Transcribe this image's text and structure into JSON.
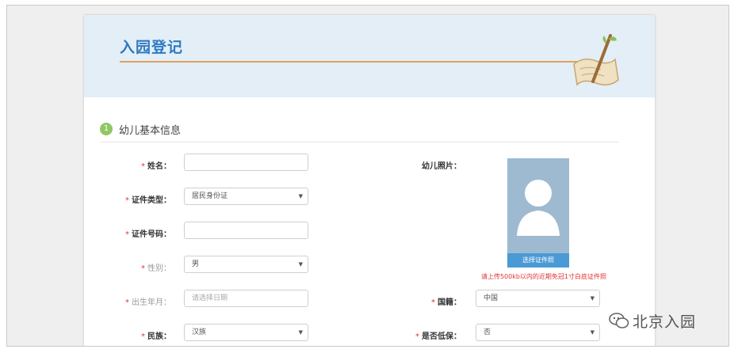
{
  "header": {
    "title": "入园登记"
  },
  "section": {
    "step": "1",
    "title": "幼儿基本信息"
  },
  "form": {
    "name": {
      "label": "姓名：",
      "value": ""
    },
    "id_type": {
      "label": "证件类型：",
      "value": "居民身份证"
    },
    "id_number": {
      "label": "证件号码：",
      "value": ""
    },
    "gender": {
      "label": "性别：",
      "value": "男"
    },
    "birth": {
      "label": "出生年月：",
      "placeholder": "请选择日期"
    },
    "ethnicity": {
      "label": "民族：",
      "value": "汉族"
    },
    "photo": {
      "label": "幼儿照片：",
      "button": "选择证件照",
      "hint": "请上传500kb以内的近期免冠1寸白底证件照"
    },
    "nationality": {
      "label": "国籍：",
      "value": "中国"
    },
    "low_income": {
      "label": "是否低保：",
      "value": "否"
    }
  },
  "required_mark": "*",
  "watermark": {
    "text": "北京入园"
  },
  "colors": {
    "accent": "#2f7ac2",
    "banner": "#e3eef7",
    "required": "#e23434",
    "step_badge": "#8fc764",
    "photo_button": "#4a9ad6"
  }
}
